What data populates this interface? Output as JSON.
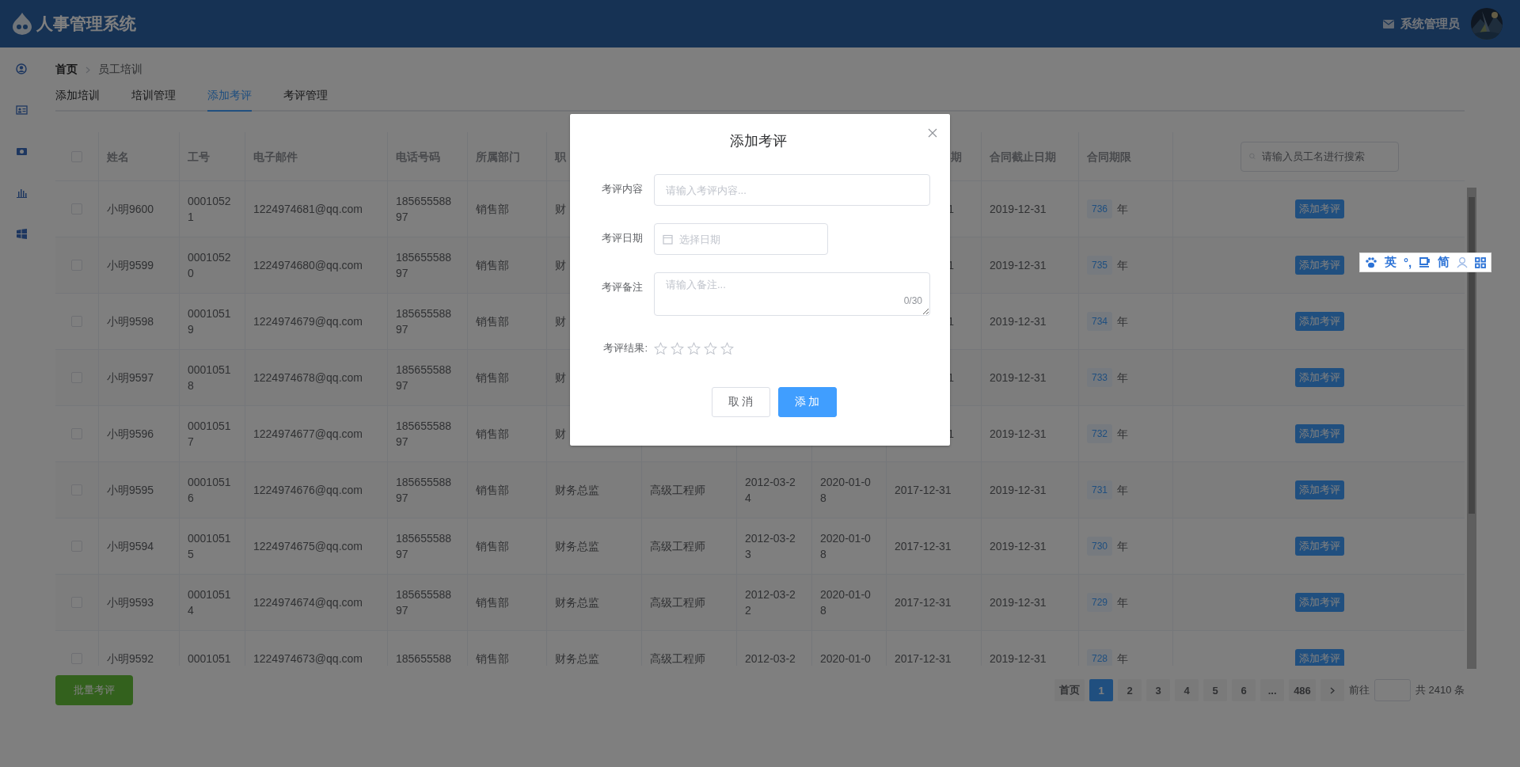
{
  "header": {
    "title": "人事管理系统",
    "user": "系统管理员"
  },
  "breadcrumb": [
    "首页",
    "员工培训"
  ],
  "tabs": [
    {
      "label": "添加培训",
      "selected": false
    },
    {
      "label": "培训管理",
      "selected": false
    },
    {
      "label": "添加考评",
      "selected": true
    },
    {
      "label": "考评管理",
      "selected": false
    }
  ],
  "table": {
    "header_checked": false,
    "columns": [
      "姓名",
      "工号",
      "电子邮件",
      "电话号码",
      "所属部门",
      "职",
      null,
      null,
      null,
      "期",
      "合同截止日期",
      "合同期限"
    ],
    "search": {
      "placeholder": "请输入员工名进行搜索"
    },
    "rows": [
      {
        "checked": false,
        "cells": [
          "小明9600",
          "00010521",
          "1224974681@qq.com",
          "18565558897",
          "销售部",
          "财",
          null,
          null,
          null,
          "1",
          "2019-12-31",
          "736"
        ],
        "unit": "年",
        "action": "添加考评"
      },
      {
        "checked": false,
        "cells": [
          "小明9599",
          "00010520",
          "1224974680@qq.com",
          "18565558897",
          "销售部",
          "财",
          null,
          null,
          null,
          "1",
          "2019-12-31",
          "735"
        ],
        "unit": "年",
        "action": "添加考评"
      },
      {
        "checked": false,
        "cells": [
          "小明9598",
          "00010519",
          "1224974679@qq.com",
          "18565558897",
          "销售部",
          "财",
          null,
          null,
          null,
          "1",
          "2019-12-31",
          "734"
        ],
        "unit": "年",
        "action": "添加考评"
      },
      {
        "checked": false,
        "cells": [
          "小明9597",
          "00010518",
          "1224974678@qq.com",
          "18565558897",
          "销售部",
          "财",
          null,
          null,
          null,
          "1",
          "2019-12-31",
          "733"
        ],
        "unit": "年",
        "action": "添加考评"
      },
      {
        "checked": false,
        "cells": [
          "小明9596",
          "00010517",
          "1224974677@qq.com",
          "18565558897",
          "销售部",
          "财",
          null,
          null,
          null,
          "1",
          "2019-12-31",
          "732"
        ],
        "unit": "年",
        "action": "添加考评"
      },
      {
        "checked": false,
        "cells": [
          "小明9595",
          "00010516",
          "1224974676@qq.com",
          "18565558897",
          "销售部",
          "财务总监",
          "高级工程师",
          "2012-03-24",
          "2020-01-08",
          "2017-12-31",
          "2019-12-31",
          "731"
        ],
        "unit": "年",
        "action": "添加考评"
      },
      {
        "checked": false,
        "cells": [
          "小明9594",
          "00010515",
          "1224974675@qq.com",
          "18565558897",
          "销售部",
          "财务总监",
          "高级工程师",
          "2012-03-23",
          "2020-01-08",
          "2017-12-31",
          "2019-12-31",
          "730"
        ],
        "unit": "年",
        "action": "添加考评"
      },
      {
        "checked": false,
        "cells": [
          "小明9593",
          "00010514",
          "1224974674@qq.com",
          "18565558897",
          "销售部",
          "财务总监",
          "高级工程师",
          "2012-03-22",
          "2020-01-08",
          "2017-12-31",
          "2019-12-31",
          "729"
        ],
        "unit": "年",
        "action": "添加考评"
      },
      {
        "checked": false,
        "cells": [
          "小明9592",
          "0001051",
          "1224974673@qq.com",
          "185655588",
          "销售部",
          "财务总监",
          "高级工程师",
          "2012-03-2",
          "2020-01-0",
          "2017-12-31",
          "2019-12-31",
          "728"
        ],
        "unit": "年",
        "action": "添加考评"
      }
    ]
  },
  "batch_button": "批量考评",
  "pagination": {
    "first": "首页",
    "pages": [
      {
        "label": "1",
        "selected": true
      },
      {
        "label": "2",
        "selected": false
      },
      {
        "label": "3",
        "selected": false
      },
      {
        "label": "4",
        "selected": false
      },
      {
        "label": "5",
        "selected": false
      },
      {
        "label": "6",
        "selected": false
      }
    ],
    "ellipsis": "...",
    "last": "486",
    "goto": "前往",
    "total": "共 2410 条"
  },
  "dialog": {
    "title": "添加考评",
    "fields": [
      {
        "kind": "text",
        "label": "考评内容",
        "placeholder": "请输入考评内容..."
      },
      {
        "kind": "date",
        "label": "考评日期",
        "placeholder": "选择日期"
      },
      {
        "kind": "textarea",
        "label": "考评备注",
        "placeholder": "请输入备注...",
        "counter": "0/30"
      },
      {
        "kind": "rating",
        "label": "考评结果:",
        "stars": 0
      }
    ],
    "buttons": [
      {
        "label": "取 消",
        "kind": "default"
      },
      {
        "label": "添 加",
        "kind": "primary"
      }
    ]
  },
  "ime_bar": [
    {
      "kind": "paw"
    },
    {
      "kind": "text",
      "text": "英"
    },
    {
      "kind": "text",
      "text": "°,"
    },
    {
      "kind": "cup"
    },
    {
      "kind": "text",
      "text": "简"
    },
    {
      "kind": "person"
    },
    {
      "kind": "grid"
    }
  ]
}
